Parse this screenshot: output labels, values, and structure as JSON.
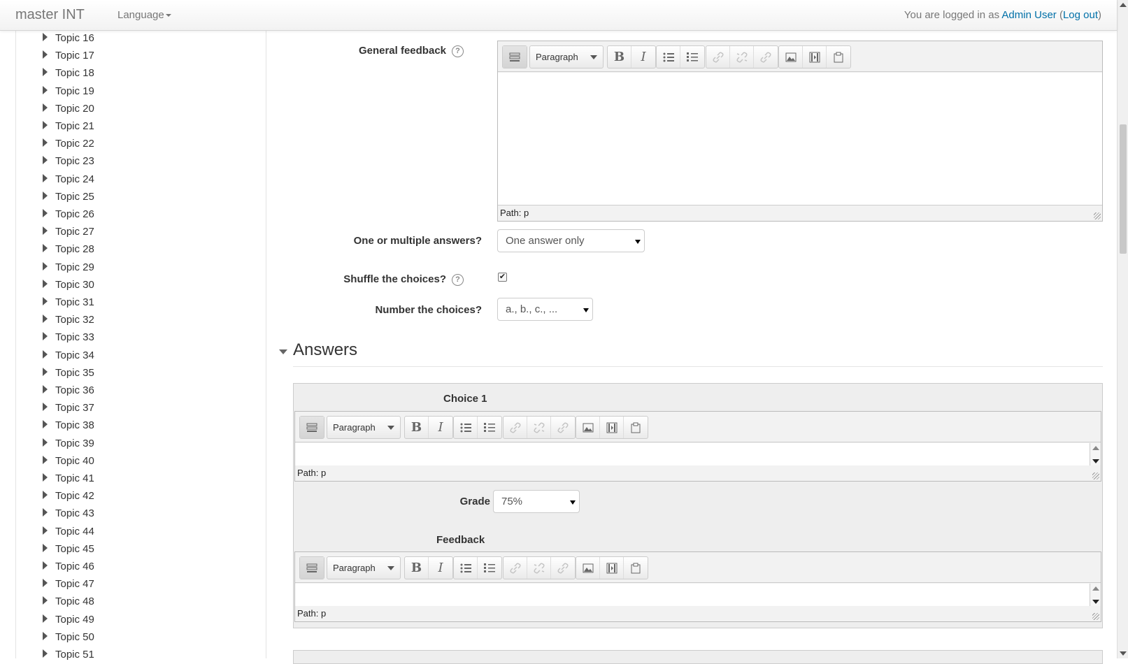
{
  "navbar": {
    "brand": "master INT",
    "language_label": "Language",
    "login_prefix": "You are logged in as ",
    "user_name": "Admin User",
    "logout_label": "Log out"
  },
  "sidebar": {
    "topics": [
      "Topic 16",
      "Topic 17",
      "Topic 18",
      "Topic 19",
      "Topic 20",
      "Topic 21",
      "Topic 22",
      "Topic 23",
      "Topic 24",
      "Topic 25",
      "Topic 26",
      "Topic 27",
      "Topic 28",
      "Topic 29",
      "Topic 30",
      "Topic 31",
      "Topic 32",
      "Topic 33",
      "Topic 34",
      "Topic 35",
      "Topic 36",
      "Topic 37",
      "Topic 38",
      "Topic 39",
      "Topic 40",
      "Topic 41",
      "Topic 42",
      "Topic 43",
      "Topic 44",
      "Topic 45",
      "Topic 46",
      "Topic 47",
      "Topic 48",
      "Topic 49",
      "Topic 50",
      "Topic 51"
    ]
  },
  "form": {
    "general_feedback_label": "General feedback",
    "help_glyph": "?",
    "one_or_multiple_label": "One or multiple answers?",
    "one_or_multiple_value": "One answer only",
    "shuffle_label": "Shuffle the choices?",
    "shuffle_checked": true,
    "shuffle_check_glyph": "✔",
    "number_label": "Number the choices?",
    "number_value": "a., b., c., ..."
  },
  "editor": {
    "paragraph": "Paragraph",
    "path": "Path: p",
    "bold": "B",
    "italic": "I"
  },
  "answers": {
    "heading": "Answers",
    "choice_label": "Choice 1",
    "grade_label": "Grade",
    "grade_value": "75%",
    "feedback_label": "Feedback"
  }
}
